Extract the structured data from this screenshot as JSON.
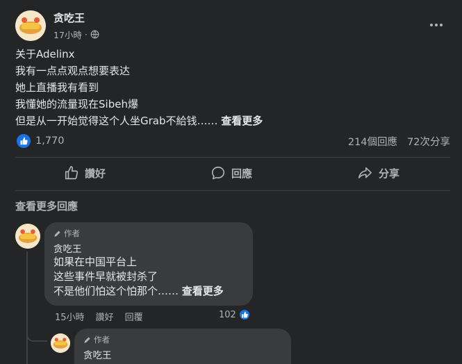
{
  "post": {
    "author": "贪吃王",
    "time": "17小時",
    "lines": [
      "关于Adelinx",
      "我有一点点观点想要表达",
      "她上直播我有看到",
      "我懂她的流量现在Sibeh爆",
      "但是从一开始觉得这个人坐Grab不給钱……"
    ],
    "see_more": "查看更多",
    "like_count": "1,770",
    "comment_count": "214個回應",
    "share_count": "72次分享"
  },
  "actions": {
    "like": "讚好",
    "comment": "回應",
    "share": "分享"
  },
  "view_more_comments": "查看更多回應",
  "comments": [
    {
      "author_tag": "作者",
      "name": "贪吃王",
      "lines": [
        "如果在中国平台上",
        "这些事件早就被封杀了",
        "不是他们怕这个怕那个……"
      ],
      "see_more": "查看更多",
      "time": "15小時",
      "like": "讚好",
      "reply": "回覆",
      "reaction_count": "102"
    },
    {
      "author_tag": "作者",
      "name": "贪吃王"
    }
  ],
  "colors": {
    "background": "#242526",
    "bubble": "#3a3b3c",
    "like_blue": "#1b74e4",
    "text_primary": "#e4e6eb",
    "text_secondary": "#b0b3b8"
  }
}
